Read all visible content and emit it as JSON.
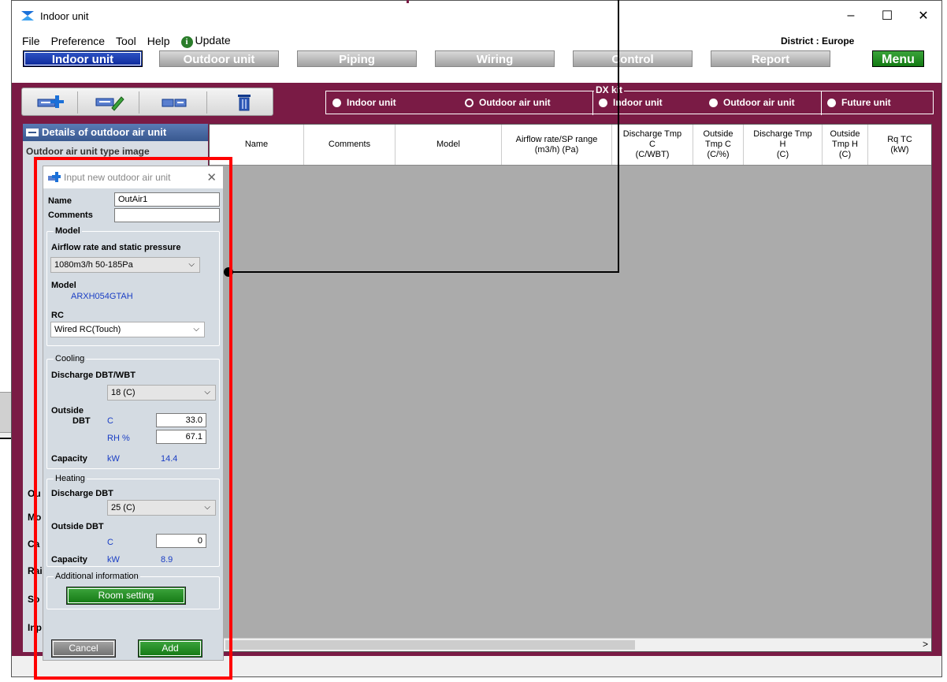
{
  "window": {
    "title": "Indoor unit",
    "controls": [
      "–",
      "☐",
      "✕"
    ]
  },
  "menu": {
    "items": [
      "File",
      "Preference",
      "Tool",
      "Help"
    ],
    "update": "Update",
    "district": "District : Europe"
  },
  "tabs": [
    "Indoor unit",
    "Outdoor unit",
    "Piping",
    "Wiring",
    "Control",
    "Report",
    "Menu"
  ],
  "radio": {
    "indoor": "Indoor unit",
    "outdoor_air": "Outdoor air unit",
    "dxkit": "DX kit",
    "dx_indoor": "Indoor unit",
    "dx_outdoor": "Outdoor air unit",
    "future": "Future unit"
  },
  "left_panel": {
    "header": "Details of outdoor air unit",
    "sub": "Outdoor air unit type image",
    "labels": [
      "Ou",
      "Mo",
      "Ca",
      "Rai",
      "So",
      "Inp"
    ]
  },
  "grid": {
    "columns": [
      "Name",
      "Comments",
      "Model",
      "Airflow rate/SP range\n(m3/h) (Pa)",
      "Discharge Tmp\nC\n(C/WBT)",
      "Outside\nTmp C\n(C/%)",
      "Discharge Tmp\nH\n(C)",
      "Outside\nTmp H\n(C)",
      "Rq TC\n(kW)"
    ]
  },
  "dialog": {
    "title": "Input new outdoor air unit",
    "name_label": "Name",
    "name_value": "OutAir1",
    "comments_label": "Comments",
    "comments_value": "",
    "model_group": "Model",
    "airflow_label": "Airflow rate and static pressure",
    "airflow_value": "1080m3/h 50-185Pa",
    "model_label": "Model",
    "model_value": "ARXH054GTAH",
    "rc_label": "RC",
    "rc_value": "Wired RC(Touch)",
    "cooling_group": "Cooling",
    "c_discharge_label": "Discharge  DBT/WBT",
    "c_discharge_value": "18 (C)",
    "c_outside_label": "Outside",
    "c_dbt_label": "DBT",
    "c_unit_c": "C",
    "c_dbt_value": "33.0",
    "c_rh_label": "RH %",
    "c_rh_value": "67.1",
    "c_capacity_label": "Capacity",
    "c_capacity_unit": "kW",
    "c_capacity_value": "14.4",
    "heating_group": "Heating",
    "h_discharge_label": "Discharge  DBT",
    "h_discharge_value": "25 (C)",
    "h_outside_label": "Outside DBT",
    "h_unit_c": "C",
    "h_dbt_value": "0",
    "h_capacity_label": "Capacity",
    "h_capacity_unit": "kW",
    "h_capacity_value": "8.9",
    "additional_group": "Additional information",
    "room_setting": "Room setting",
    "cancel": "Cancel",
    "add": "Add"
  },
  "colors": {
    "maroon": "#7a1b45",
    "highlight": "#ff0000",
    "accent_blue": "#1a3ec4"
  }
}
